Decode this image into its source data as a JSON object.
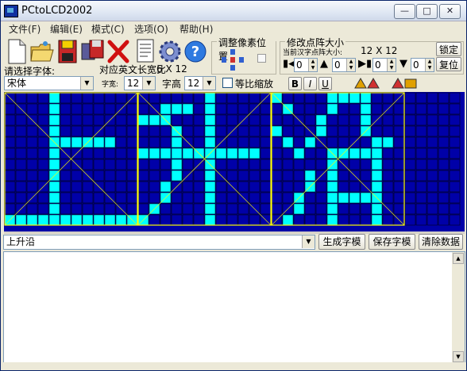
{
  "window": {
    "title": "PCtoLCD2002"
  },
  "menu": [
    "文件(F)",
    "编辑(E)",
    "模式(C)",
    "选项(O)",
    "帮助(H)"
  ],
  "font_panel": {
    "choose_font_label": "请选择字体:",
    "font_name": "宋体",
    "en_ratio_label": "对应英文长宽比",
    "en_ratio_value": "6 X 12",
    "width_label": "字宽:",
    "width_value": "12",
    "height_label": "字高",
    "height_value": "12",
    "scale_label": "等比缩放",
    "bold": "B",
    "italic": "I",
    "underline": "U"
  },
  "pixel_pos": {
    "title": "调整像素位置"
  },
  "matrix_size": {
    "title": "修改点阵大小",
    "current_label": "当前汉字点阵大小:",
    "current_value": "12 X 12",
    "spin1": "0",
    "spin2": "0",
    "spin3": "0",
    "spin4": "0",
    "lock_button": "锁定",
    "reset_button": "复位"
  },
  "colors": {
    "grid_bg": "#0000a8",
    "pixel_on": "#00ffff",
    "grid_line": "#000000",
    "guide": "#ffff00"
  },
  "glyphs": [
    "上",
    "升",
    "沿"
  ],
  "bottom": {
    "text_value": "上升沿",
    "generate_button": "生成字模",
    "save_button": "保存字模",
    "clear_button": "清除数据"
  }
}
